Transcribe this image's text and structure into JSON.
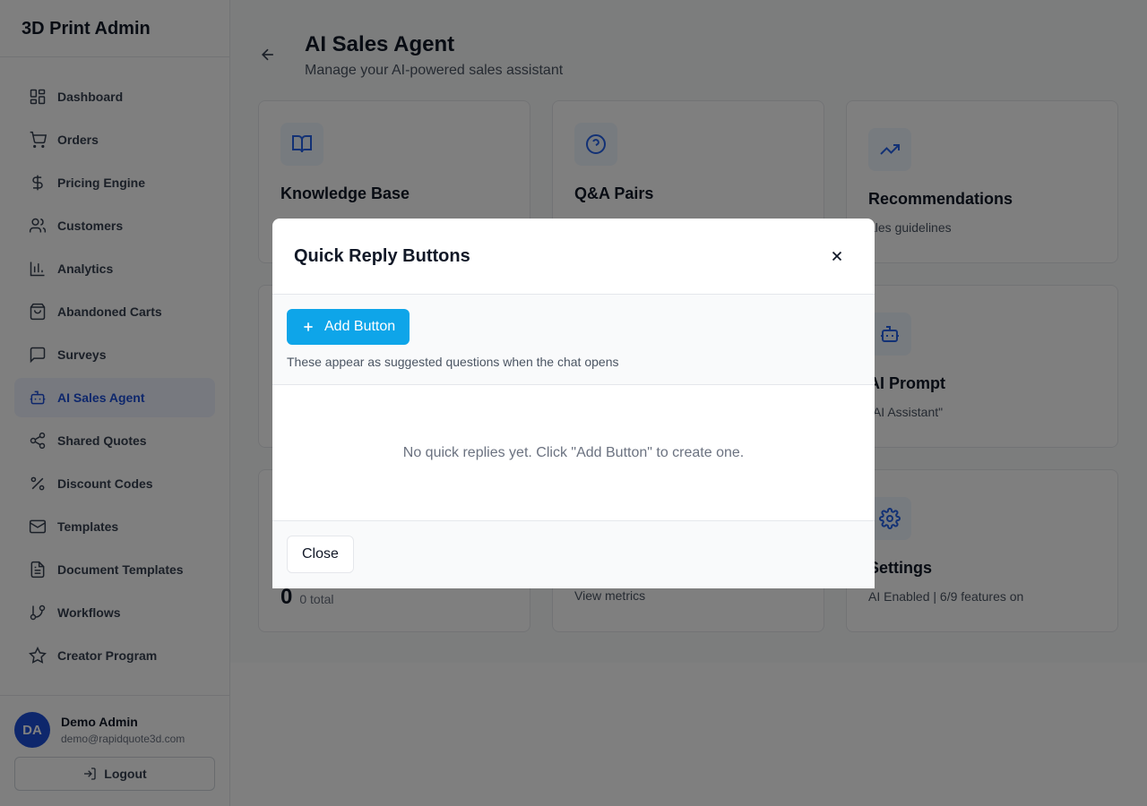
{
  "app": {
    "title": "3D Print Admin"
  },
  "sidebar": {
    "items": [
      {
        "label": "Dashboard",
        "icon": "dashboard-icon"
      },
      {
        "label": "Orders",
        "icon": "cart-icon"
      },
      {
        "label": "Pricing Engine",
        "icon": "dollar-icon"
      },
      {
        "label": "Customers",
        "icon": "users-icon"
      },
      {
        "label": "Analytics",
        "icon": "bar-chart-icon"
      },
      {
        "label": "Abandoned Carts",
        "icon": "shopping-bag-icon"
      },
      {
        "label": "Surveys",
        "icon": "message-square-icon"
      },
      {
        "label": "AI Sales Agent",
        "icon": "bot-icon",
        "active": true
      },
      {
        "label": "Shared Quotes",
        "icon": "share-icon"
      },
      {
        "label": "Discount Codes",
        "icon": "percent-icon"
      },
      {
        "label": "Templates",
        "icon": "mail-icon"
      },
      {
        "label": "Document Templates",
        "icon": "file-text-icon"
      },
      {
        "label": "Workflows",
        "icon": "git-branch-icon"
      },
      {
        "label": "Creator Program",
        "icon": "star-icon"
      }
    ]
  },
  "user": {
    "initials": "DA",
    "name": "Demo Admin",
    "email": "demo@rapidquote3d.com",
    "logout_label": "Logout"
  },
  "page": {
    "title": "AI Sales Agent",
    "subtitle": "Manage your AI-powered sales assistant"
  },
  "cards": {
    "knowledge": {
      "title": "Knowledge Base"
    },
    "qa": {
      "title": "Q&A Pairs"
    },
    "recommendations": {
      "title": "Recommendations",
      "desc": "ales guidelines"
    },
    "prompt": {
      "title": "AI Prompt",
      "desc": "\"AI Assistant\""
    },
    "quick_replies": {
      "count": "0",
      "count_label": "0 total"
    },
    "analytics": {
      "desc": "View metrics"
    },
    "settings": {
      "title": "Settings",
      "desc": "AI Enabled | 6/9 features on"
    }
  },
  "modal": {
    "title": "Quick Reply Buttons",
    "add_label": "Add Button",
    "hint": "These appear as suggested questions when the chat opens",
    "empty_text": "No quick replies yet. Click \"Add Button\" to create one.",
    "close_label": "Close"
  },
  "colors": {
    "accent": "#0ea5e9",
    "active_nav": "#1d4ed8",
    "avatar": "#1d4ed8"
  }
}
